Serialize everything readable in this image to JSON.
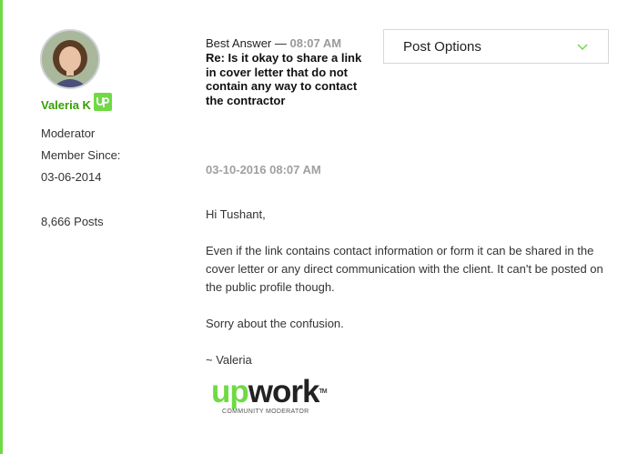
{
  "author": {
    "name": "Valeria K",
    "badge_icon": "upwork-up-badge-icon",
    "role": "Moderator",
    "member_since_label": "Member Since:",
    "member_since_date": "03-06-2014",
    "posts": "8,666 Posts"
  },
  "post": {
    "best_answer_label": "Best Answer —",
    "best_answer_time": "08:07 AM",
    "subject": "Re: Is it okay to share a link in cover letter that do not contain any way to contact the contractor",
    "options_label": "Post Options",
    "date": "03-10-2016 08:07 AM",
    "body": [
      "Hi Tushant,",
      "Even if the link contains contact information or form it can be shared in the cover letter or any direct communication with the client. It can't be posted on the public profile though.",
      "Sorry about the confusion.",
      "~ Valeria"
    ]
  },
  "signature": {
    "logo_up": "up",
    "logo_work": "work",
    "logo_tm": "TM",
    "logo_sub": "COMMUNITY MODERATOR"
  },
  "colors": {
    "accent_green": "#6fda44",
    "name_green": "#37a000"
  }
}
